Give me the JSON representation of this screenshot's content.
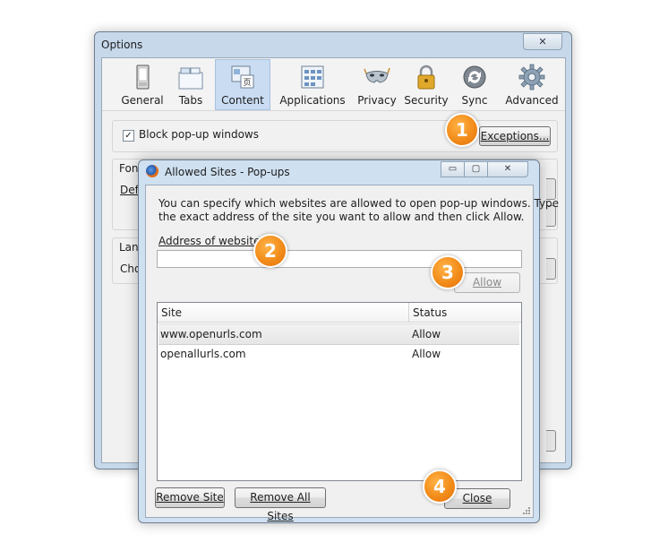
{
  "options_window": {
    "title": "Options",
    "close_glyph": "✕",
    "toolbar": [
      {
        "label": "General",
        "icon": "general-icon"
      },
      {
        "label": "Tabs",
        "icon": "tabs-icon"
      },
      {
        "label": "Content",
        "icon": "content-icon",
        "selected": true
      },
      {
        "label": "Applications",
        "icon": "applications-icon"
      },
      {
        "label": "Privacy",
        "icon": "privacy-mask-icon"
      },
      {
        "label": "Security",
        "icon": "padlock-icon"
      },
      {
        "label": "Sync",
        "icon": "sync-icon"
      },
      {
        "label": "Advanced",
        "icon": "gear-icon"
      }
    ],
    "block_popups": {
      "label": "Block pop-up windows",
      "checked": true
    },
    "exceptions_button": "Exceptions...",
    "partial_labels": {
      "fonts": "Font",
      "default": "Defa",
      "languages": "Lang",
      "choose": "Cho"
    }
  },
  "allowed_window": {
    "title": "Allowed Sites - Pop-ups",
    "caption_buttons": {
      "minimize": "▭",
      "maximize": "▢",
      "close": "✕"
    },
    "description_line1": "You can specify which websites are allowed to open pop-up windows. Type",
    "description_line2": "the exact address of the site you want to allow and then click Allow.",
    "address_label": "Address of website:",
    "address_value": "",
    "allow_button": "Allow",
    "columns": [
      "Site",
      "Status"
    ],
    "rows": [
      {
        "site": "www.openurls.com",
        "status": "Allow"
      },
      {
        "site": "openallurls.com",
        "status": "Allow"
      }
    ],
    "remove_site_button": "Remove Site",
    "remove_all_button": "Remove All Sites",
    "close_button": "Close"
  },
  "badges": [
    "1",
    "2",
    "3",
    "4"
  ],
  "colors": {
    "badge": "#f28c1a",
    "selected_tab": "#c9dcf2",
    "frame": "#c6d8ea"
  }
}
